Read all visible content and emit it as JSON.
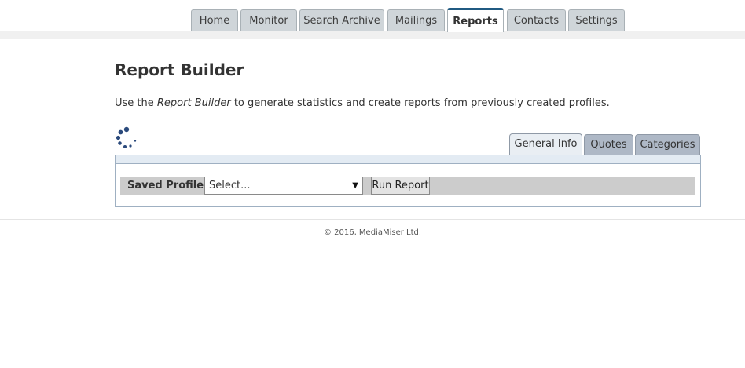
{
  "nav": {
    "tabs": [
      {
        "label": "Home",
        "active": false
      },
      {
        "label": "Monitor",
        "active": false
      },
      {
        "label": "Search Archive",
        "active": false
      },
      {
        "label": "Mailings",
        "active": false
      },
      {
        "label": "Reports",
        "active": true
      },
      {
        "label": "Contacts",
        "active": false
      },
      {
        "label": "Settings",
        "active": false
      }
    ]
  },
  "page": {
    "title": "Report Builder",
    "intro_before": "Use the ",
    "intro_emphasis": "Report Builder",
    "intro_after": " to generate statistics and create reports from previously created profiles."
  },
  "spinner": {
    "icon": "loading-spinner-icon",
    "color": "#2b4a7c"
  },
  "subtabs": [
    {
      "label": "General Info",
      "active": true
    },
    {
      "label": "Quotes",
      "active": false
    },
    {
      "label": "Categories",
      "active": false
    }
  ],
  "toolbar": {
    "saved_profiles_label": "Saved Profiles:",
    "select_value": "Select...",
    "select_arrow": "▼",
    "run_report_label": "Run Report"
  },
  "footer": {
    "copyright": "© 2016, MediaMiser Ltd."
  },
  "colors": {
    "accent": "#205a82",
    "nav_tab_bg": "#cfd5d9",
    "subtab_bg": "#aeb8c6",
    "toolbar_bg": "#cccccc"
  }
}
